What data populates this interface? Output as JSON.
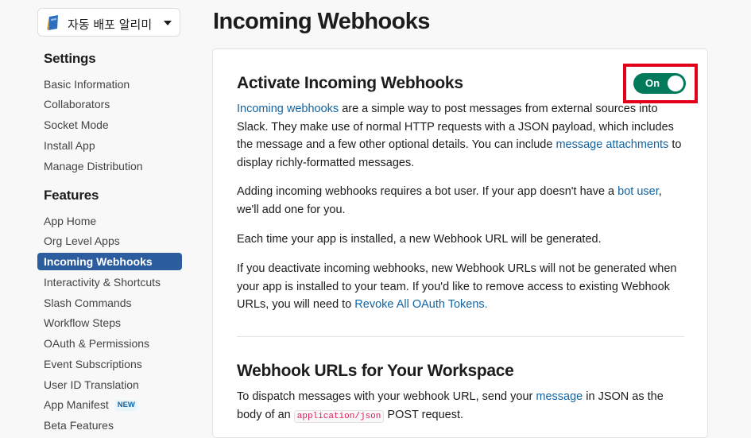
{
  "sidebar": {
    "app_name": "자동 배포 알리미",
    "settings_title": "Settings",
    "settings_items": [
      {
        "label": "Basic Information"
      },
      {
        "label": "Collaborators"
      },
      {
        "label": "Socket Mode"
      },
      {
        "label": "Install App"
      },
      {
        "label": "Manage Distribution"
      }
    ],
    "features_title": "Features",
    "features_items": [
      {
        "label": "App Home"
      },
      {
        "label": "Org Level Apps"
      },
      {
        "label": "Incoming Webhooks",
        "active": true
      },
      {
        "label": "Interactivity & Shortcuts"
      },
      {
        "label": "Slash Commands"
      },
      {
        "label": "Workflow Steps"
      },
      {
        "label": "OAuth & Permissions"
      },
      {
        "label": "Event Subscriptions"
      },
      {
        "label": "User ID Translation"
      },
      {
        "label": "App Manifest",
        "badge": "NEW"
      },
      {
        "label": "Beta Features"
      }
    ]
  },
  "page": {
    "title": "Incoming Webhooks"
  },
  "activate": {
    "heading": "Activate Incoming Webhooks",
    "toggle_label": "On",
    "toggle_state": "on",
    "p1": {
      "link1": "Incoming webhooks",
      "text1": " are a simple way to post messages from external sources into Slack. They make use of normal HTTP requests with a JSON payload, which includes the message and a few other optional details. You can include ",
      "link2": "message attachments",
      "text2": " to display richly-formatted messages."
    },
    "p2": {
      "text1": "Adding incoming webhooks requires a bot user. If your app doesn't have a ",
      "link1": "bot user",
      "text2": ", we'll add one for you."
    },
    "p3": "Each time your app is installed, a new Webhook URL will be generated.",
    "p4": {
      "text1": "If you deactivate incoming webhooks, new Webhook URLs will not be generated when your app is installed to your team. If you'd like to remove access to existing Webhook URLs, you will need to ",
      "link1": "Revoke All OAuth Tokens."
    }
  },
  "workspace": {
    "heading": "Webhook URLs for Your Workspace",
    "p1": {
      "text1": "To dispatch messages with your webhook URL, send your ",
      "link1": "message",
      "text2": " in JSON as the body of an ",
      "code": "application/json",
      "text3": " POST request."
    }
  },
  "colors": {
    "accent": "#1264a3",
    "active_nav": "#2c5e9f",
    "toggle_on": "#007a5a",
    "highlight": "#e3001b"
  }
}
